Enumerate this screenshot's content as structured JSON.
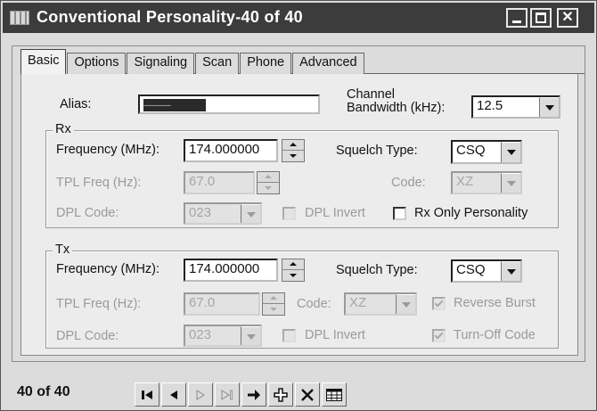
{
  "window": {
    "title": "Conventional Personality-40 of 40"
  },
  "tabs": [
    {
      "label": "Basic",
      "active": true
    },
    {
      "label": "Options",
      "active": false
    },
    {
      "label": "Signaling",
      "active": false
    },
    {
      "label": "Scan",
      "active": false
    },
    {
      "label": "Phone",
      "active": false
    },
    {
      "label": "Advanced",
      "active": false
    }
  ],
  "basic": {
    "alias_label": "Alias:",
    "alias_value": "---------------",
    "bandwidth_label_line1": "Channel",
    "bandwidth_label_line2": "Bandwidth (kHz):",
    "bandwidth_value": "12.5"
  },
  "rx": {
    "group_title": "Rx",
    "frequency_label": "Frequency (MHz):",
    "frequency_value": "174.000000",
    "squelch_label": "Squelch Type:",
    "squelch_value": "CSQ",
    "tpl_label": "TPL Freq (Hz):",
    "tpl_value": "67.0",
    "code_label": "Code:",
    "code_value": "XZ",
    "dpl_label": "DPL Code:",
    "dpl_value": "023",
    "dpl_invert_label": "DPL Invert",
    "dpl_invert_checked": false,
    "rx_only_label": "Rx Only Personality",
    "rx_only_checked": false
  },
  "tx": {
    "group_title": "Tx",
    "frequency_label": "Frequency (MHz):",
    "frequency_value": "174.000000",
    "squelch_label": "Squelch Type:",
    "squelch_value": "CSQ",
    "tpl_label": "TPL Freq (Hz):",
    "tpl_value": "67.0",
    "code_label": "Code:",
    "code_value": "XZ",
    "reverse_burst_label": "Reverse Burst",
    "reverse_burst_checked": true,
    "dpl_label": "DPL Code:",
    "dpl_value": "023",
    "dpl_invert_label": "DPL Invert",
    "dpl_invert_checked": false,
    "turn_off_label": "Turn-Off Code",
    "turn_off_checked": true
  },
  "navigation": {
    "record_count": "40 of 40",
    "buttons": [
      "first-record-icon",
      "previous-record-icon",
      "next-record-icon",
      "last-record-icon",
      "goto-arrow-icon",
      "add-record-icon",
      "delete-record-icon",
      "grid-view-icon"
    ]
  }
}
